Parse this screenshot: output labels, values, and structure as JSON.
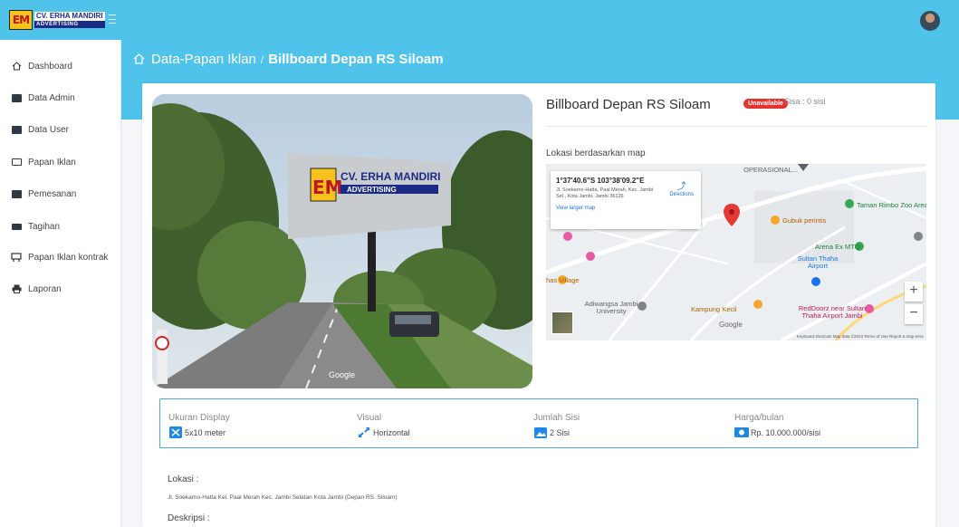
{
  "brand": {
    "logo_mark": "EM",
    "line1": "CV. ERHA MANDIRI",
    "line2": "ADVERTISING"
  },
  "sidebar": {
    "items": [
      {
        "label": "Dashboard",
        "icon": "home-icon"
      },
      {
        "label": "Data Admin",
        "icon": "id-card-icon"
      },
      {
        "label": "Data User",
        "icon": "id-card-icon"
      },
      {
        "label": "Papan Iklan",
        "icon": "monitor-icon"
      },
      {
        "label": "Pemesanan",
        "icon": "list-icon"
      },
      {
        "label": "Tagihan",
        "icon": "money-icon"
      },
      {
        "label": "Papan Iklan kontrak",
        "icon": "billboard-icon"
      },
      {
        "label": "Laporan",
        "icon": "printer-icon"
      }
    ]
  },
  "breadcrumb": {
    "parent": "Data-Papan Iklan",
    "current": "Billboard Depan RS Siloam"
  },
  "detail": {
    "title": "Billboard Depan RS Siloam",
    "status_badge": "Unavailable",
    "sisa": "Sisa : 0 sisi",
    "map_label": "Lokasi berdasarkan map"
  },
  "photo": {
    "sign_line1": "CV. ERHA MANDIRI",
    "sign_line2": "ADVERTISING",
    "watermark": "Google"
  },
  "map": {
    "coord": "1°37'40.6\"S 103°38'09.2\"E",
    "address": "Jl. Soekarno-Hatta, Paal Merah, Kec. Jambi Sel., Kota Jambi, Jambi 36126",
    "view_larger": "View larger map",
    "directions": "Directions",
    "labels": {
      "operasional": "OPERASIONAL...",
      "taman": "Taman Rimbo Zoo Area",
      "gubuk": "Gubuk perintis",
      "arena": "Arena Ex MTQ",
      "airport": "Sultan Thaha Airport",
      "reddoorz": "RedDoorz near Sultan Thaha Airport Jambi",
      "adiwangsa": "Adiwangsa Jambi University",
      "kampung": "Kampung Kecil",
      "village": "has Village",
      "google": "Google",
      "footer": "Keyboard shortcuts   Map data ©2023   Terms of Use   Report a map error"
    },
    "zoom_in": "+",
    "zoom_out": "−"
  },
  "specs": [
    {
      "label": "Ukuran Display",
      "value": "5x10 meter",
      "icon": "expand-icon"
    },
    {
      "label": "Visual",
      "value": "Horizontal",
      "icon": "diagonal-arrows-icon"
    },
    {
      "label": "Jumlah Sisi",
      "value": "2 Sisi",
      "icon": "image-icon"
    },
    {
      "label": "Harga/bulan",
      "value": "Rp. 10.000.000/sisi",
      "icon": "money-bill-icon"
    }
  ],
  "lokasi": {
    "title": "Lokasi :",
    "text": "Jl. Soekarno-Hatta Kel. Paal Merah Kec. Jambi Selatan Kota Jambi (Depan RS. Siloam)"
  },
  "deskripsi": {
    "title": "Deskripsi :"
  },
  "colors": {
    "primary": "#4fc3ea",
    "badge": "#e3342f",
    "spec_border": "#4fa8d8"
  }
}
